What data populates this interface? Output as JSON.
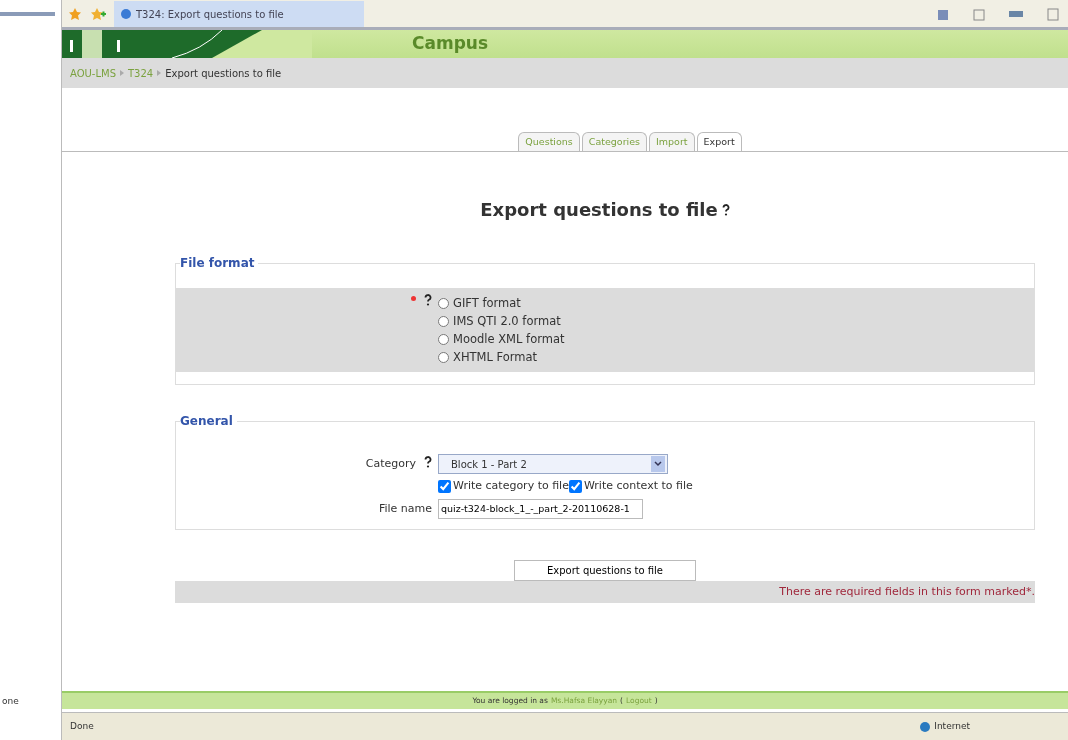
{
  "browser": {
    "tab_title": "T324: Export questions to file"
  },
  "side_panel": {
    "text": "one"
  },
  "header": {
    "site_name": "Campus"
  },
  "breadcrumb": [
    {
      "label": "AOU-LMS",
      "link": true
    },
    {
      "label": "T324",
      "link": true
    },
    {
      "label": "Export questions to file",
      "link": false
    }
  ],
  "tabs": [
    {
      "label": "Questions",
      "selected": false
    },
    {
      "label": "Categories",
      "selected": false
    },
    {
      "label": "Import",
      "selected": false
    },
    {
      "label": "Export",
      "selected": true
    }
  ],
  "title": "Export questions to file",
  "file_format": {
    "legend": "File format",
    "required": true,
    "options": [
      {
        "label": "GIFT format",
        "selected": false
      },
      {
        "label": "IMS QTI 2.0 format",
        "selected": false
      },
      {
        "label": "Moodle XML format",
        "selected": false
      },
      {
        "label": "XHTML Format",
        "selected": false
      }
    ]
  },
  "general": {
    "legend": "General",
    "category": {
      "label": "Category",
      "value": "Block 1 - Part 2"
    },
    "checkboxes": [
      {
        "label": "Write category to file",
        "checked": true
      },
      {
        "label": "Write context to file",
        "checked": true
      }
    ],
    "file_name": {
      "label": "File name",
      "value": "quiz-t324-block_1_-_part_2-20110628-1"
    }
  },
  "submit": "Export questions to file",
  "required_note": "There are required fields in this form marked*.",
  "footer": [
    {
      "text": "You are logged in as",
      "link": false
    },
    {
      "text": "Ms.Hafsa Elayyan",
      "link": true
    },
    {
      "text": "(",
      "link": false
    },
    {
      "text": "Logout",
      "link": true
    },
    {
      "text": ")",
      "link": false
    }
  ],
  "status_bar": {
    "text": "Done",
    "zone": "Internet"
  }
}
